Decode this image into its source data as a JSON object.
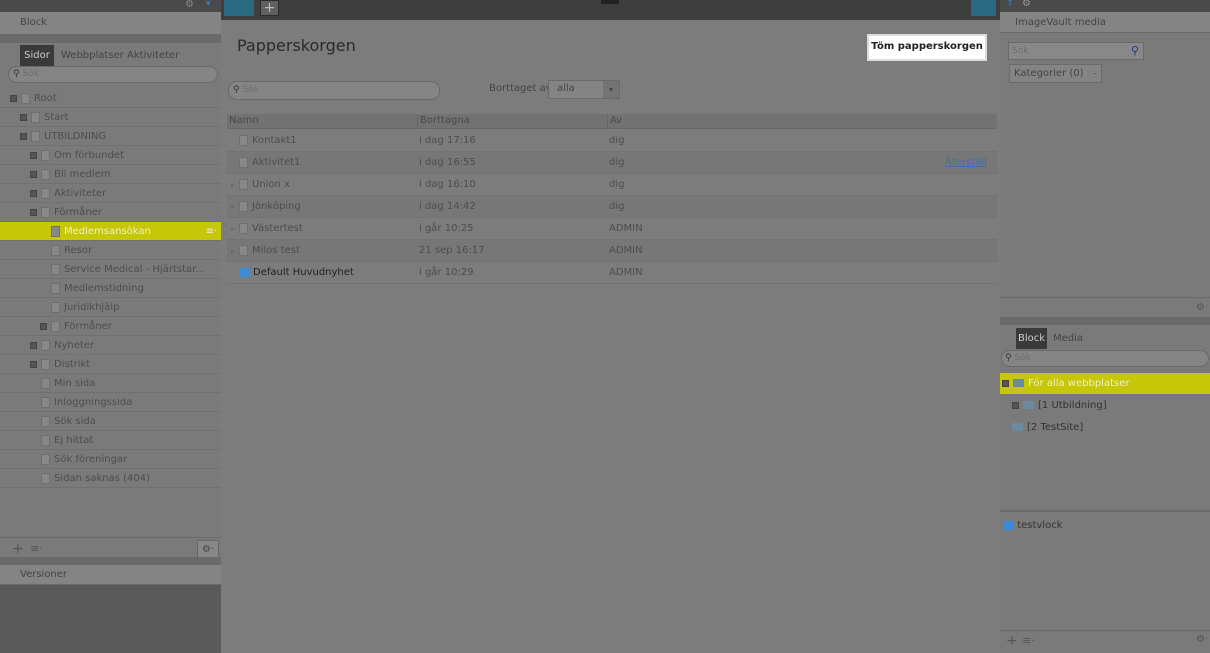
{
  "left": {
    "panel_title": "Block",
    "tabs": [
      "Sidor",
      "Webbplatser",
      "Aktiviteter"
    ],
    "search_placeholder": "Sök",
    "tree": [
      {
        "label": "Root",
        "indent": 0,
        "expander": true
      },
      {
        "label": "Start",
        "indent": 1,
        "expander": true
      },
      {
        "label": "UTBILDNING",
        "indent": 1,
        "expander": true
      },
      {
        "label": "Om förbundet",
        "indent": 2,
        "expander": true
      },
      {
        "label": "Bli medlem",
        "indent": 2,
        "expander": true
      },
      {
        "label": "Aktiviteter",
        "indent": 2,
        "expander": true
      },
      {
        "label": "Förmåner",
        "indent": 2,
        "expander": true
      },
      {
        "label": "Medlemsansökan",
        "indent": 3,
        "expander": false,
        "selected": true
      },
      {
        "label": "Resor",
        "indent": 3,
        "expander": false
      },
      {
        "label": "Service Medical - Hjärtstar...",
        "indent": 3,
        "expander": false
      },
      {
        "label": "Medlemstidning",
        "indent": 3,
        "expander": false
      },
      {
        "label": "Juridikhjälp",
        "indent": 3,
        "expander": false
      },
      {
        "label": "Förmåner",
        "indent": 3,
        "expander": true
      },
      {
        "label": "Nyheter",
        "indent": 2,
        "expander": true
      },
      {
        "label": "Distrikt",
        "indent": 2,
        "expander": true
      },
      {
        "label": "Min sida",
        "indent": 2,
        "expander": false
      },
      {
        "label": "Inloggningssida",
        "indent": 2,
        "expander": false
      },
      {
        "label": "Sök sida",
        "indent": 2,
        "expander": false
      },
      {
        "label": "Ej hittat",
        "indent": 2,
        "expander": false
      },
      {
        "label": "Sök föreningar",
        "indent": 2,
        "expander": false
      },
      {
        "label": "Sidan saknas (404)",
        "indent": 2,
        "expander": false
      }
    ],
    "versions_label": "Versioner"
  },
  "main": {
    "title": "Papperskorgen",
    "empty_button": "Töm papperskorgen",
    "search_placeholder": "Sök",
    "deleted_by_label": "Borttaget av",
    "deleted_by_value": "alla",
    "columns": [
      "Namn",
      "Borttagna",
      "Av"
    ],
    "rows": [
      {
        "name": "Kontakt1",
        "deleted": "i dag 17:16",
        "by": "dig",
        "icon": "page",
        "expander": false
      },
      {
        "name": "Aktivitet1",
        "deleted": "i dag 16:55",
        "by": "dig",
        "icon": "page",
        "expander": false,
        "restore": "Återställ"
      },
      {
        "name": "Union x",
        "deleted": "i dag 16:10",
        "by": "dig",
        "icon": "page",
        "expander": true
      },
      {
        "name": "Jönköping",
        "deleted": "i dag 14:42",
        "by": "dig",
        "icon": "page",
        "expander": true
      },
      {
        "name": "Västertest",
        "deleted": "i går 10:25",
        "by": "ADMIN",
        "icon": "page",
        "expander": true
      },
      {
        "name": "Milos test",
        "deleted": "21 sep 16:17",
        "by": "ADMIN",
        "icon": "page",
        "expander": true
      },
      {
        "name": "Default Huvudnyhet",
        "deleted": "i går 10:29",
        "by": "ADMIN",
        "icon": "block",
        "expander": false
      }
    ]
  },
  "right": {
    "media_title": "ImageVault media",
    "search_placeholder": "Sök",
    "categories_label": "Kategorier (0)",
    "tabs": [
      "Block",
      "Media"
    ],
    "search2_placeholder": "Sök",
    "tree": [
      {
        "label": "För alla webbplatser",
        "selected": true
      },
      {
        "label": "[1 Utbildning]"
      },
      {
        "label": "[2 TestSite]"
      }
    ],
    "block_item": "testvlock"
  },
  "colors": {
    "selected": "#c7c70a",
    "block_icon": "#3a8cd8",
    "link": "#3b6fb0"
  }
}
